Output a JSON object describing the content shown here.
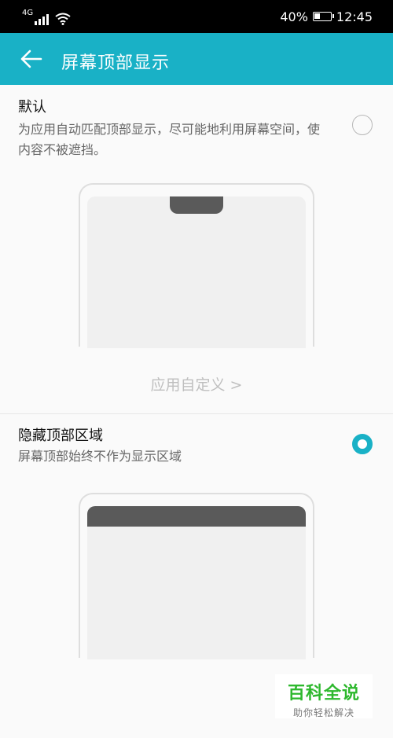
{
  "status_bar": {
    "network": "4G",
    "battery_percent": "40%",
    "battery_level": 0.4,
    "time": "12:45"
  },
  "app_bar": {
    "title": "屏幕顶部显示"
  },
  "options": [
    {
      "title": "默认",
      "description": "为应用自动匹配顶部显示，尽可能地利用屏幕空间，使内容不被遮挡。",
      "selected": false
    },
    {
      "title": "隐藏顶部区域",
      "description": "屏幕顶部始终不作为显示区域",
      "selected": true
    }
  ],
  "app_custom_link": "应用自定义 >",
  "watermark": {
    "main": "百科全说",
    "sub": "助你轻松解决"
  },
  "colors": {
    "accent": "#19b1c6",
    "notch": "#5a5a5a"
  }
}
